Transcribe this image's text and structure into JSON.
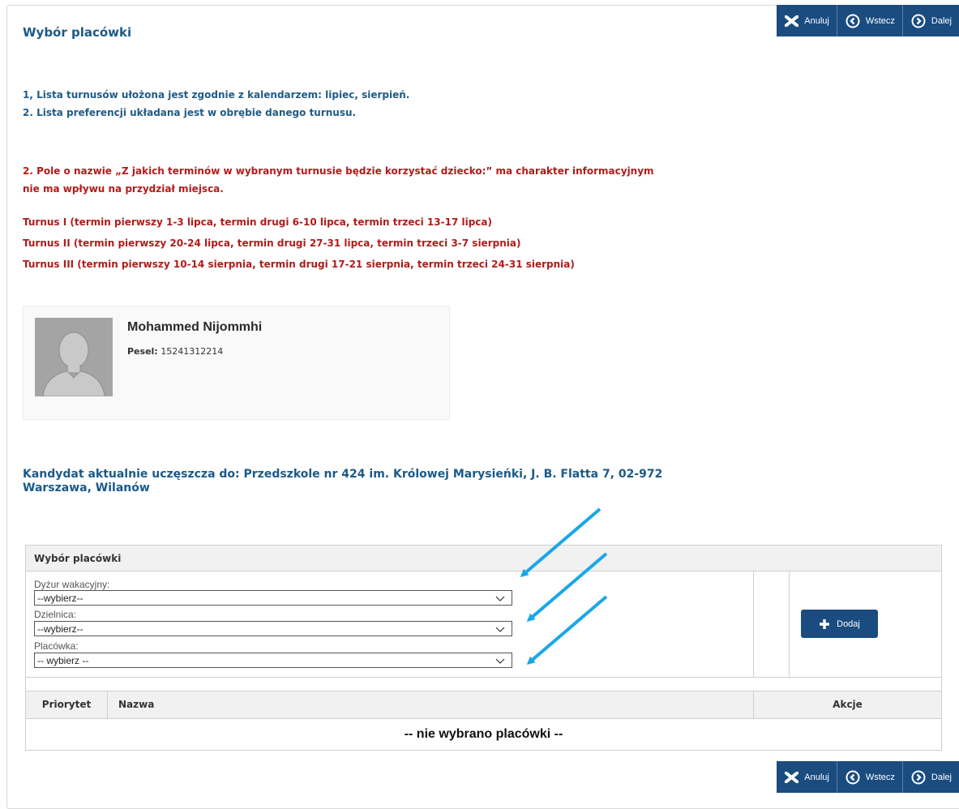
{
  "toolbar": {
    "cancel_label": "Anuluj",
    "back_label": "Wstecz",
    "next_label": "Dalej"
  },
  "page": {
    "title": "Wybór placówki"
  },
  "info": {
    "line1": "1, Lista turnusów ułożona jest zgodnie z kalendarzem: lipiec, sierpień.",
    "line2": "2. Lista preferencji układana jest w obrębie danego turnusu.",
    "note": "2. Pole o nazwie „Z jakich terminów w wybranym turnusie będzie korzystać dziecko:” ma charakter informacyjnym nie ma wpływu na przydział miejsca.",
    "turnus": [
      "Turnus I (termin pierwszy 1-3 lipca, termin drugi 6-10 lipca, termin trzeci 13-17 lipca)",
      "Turnus II (termin pierwszy 20-24 lipca, termin drugi 27-31 lipca, termin trzeci 3-7 sierpnia)",
      "Turnus III (termin pierwszy 10-14 sierpnia, termin drugi 17-21 sierpnia, termin trzeci 24-31 sierpnia)"
    ]
  },
  "candidate": {
    "name": "Mohammed Nijommhi",
    "pesel_label": "Pesel:",
    "pesel": "15241312214",
    "attends": "Kandydat aktualnie uczęszcza do: Przedszkole nr 424 im. Królowej Marysieńki, J. B. Flatta 7, 02-972 Warszawa, Wilanów"
  },
  "panel": {
    "title": "Wybór placówki",
    "fields": [
      {
        "label": "Dyżur wakacyjny:",
        "value": "--wybierz--"
      },
      {
        "label": "Dzielnica:",
        "value": "--wybierz--"
      },
      {
        "label": "Placówka:",
        "value": "-- wybierz --"
      }
    ],
    "add_label": "Dodaj",
    "columns": {
      "priority": "Priorytet",
      "name": "Nazwa",
      "actions": "Akcje"
    },
    "empty": "-- nie wybrano placówki --"
  },
  "colors": {
    "accent": "#1a4c80",
    "title": "#1a5a8a",
    "alert": "#b21b1b",
    "arrow": "#1aa7e8"
  }
}
